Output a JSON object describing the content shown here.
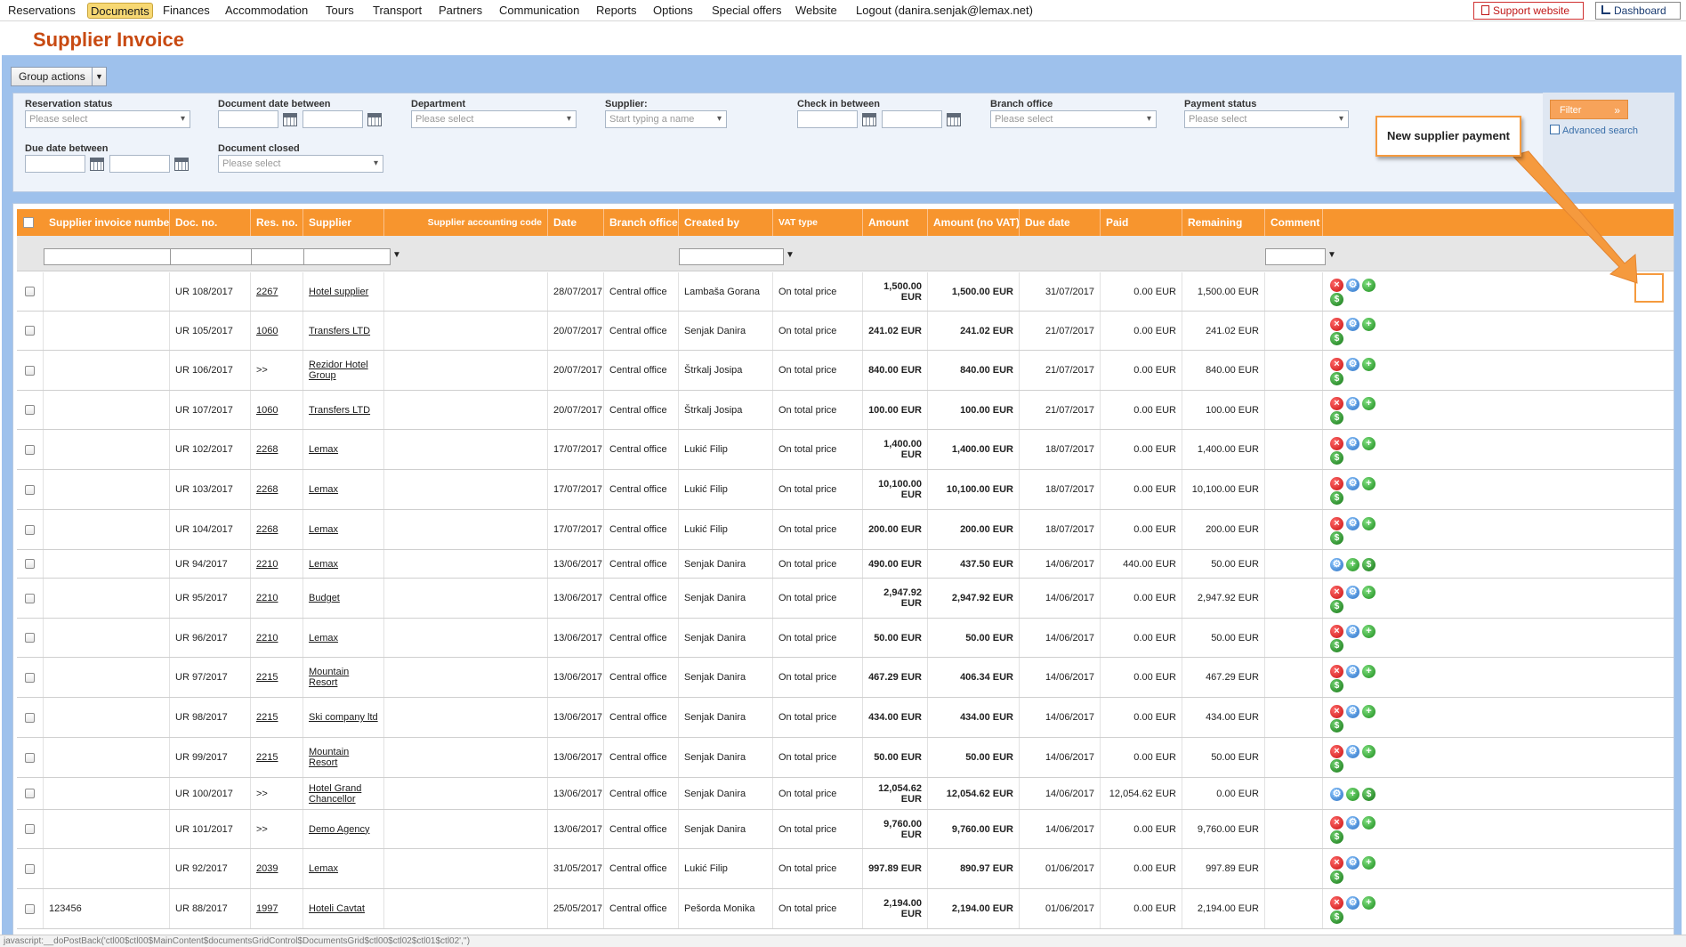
{
  "nav": {
    "items": [
      "Reservations",
      "Documents",
      "Finances",
      "Accommodation",
      "Tours",
      "Transport",
      "Partners",
      "Communication",
      "Reports",
      "Options",
      "Special offers",
      "Website",
      "Logout (danira.senjak@lemax.net)"
    ],
    "active": "Documents",
    "support_label": "Support website",
    "dashboard_label": "Dashboard"
  },
  "page": {
    "title": "Supplier Invoice"
  },
  "group_actions_label": "Group actions",
  "filters": {
    "reservation_status": {
      "label": "Reservation status",
      "placeholder": "Please select"
    },
    "document_date": {
      "label": "Document date between"
    },
    "department": {
      "label": "Department",
      "placeholder": "Please select"
    },
    "supplier": {
      "label": "Supplier:",
      "placeholder": "Start typing a name"
    },
    "check_in": {
      "label": "Check in between"
    },
    "branch_office": {
      "label": "Branch office",
      "placeholder": "Please select"
    },
    "payment_status": {
      "label": "Payment status",
      "placeholder": "Please select"
    },
    "due_date": {
      "label": "Due date between"
    },
    "document_closed": {
      "label": "Document closed",
      "placeholder": "Please select"
    },
    "filter_button": "Filter",
    "advanced_search": "Advanced search"
  },
  "callout": {
    "text": "New supplier payment"
  },
  "columns": [
    "Supplier invoice number",
    "Doc. no.",
    "Res. no.",
    "Supplier",
    "Supplier accounting code",
    "Date",
    "Branch office",
    "Created by",
    "VAT type",
    "Amount",
    "Amount (no VAT)",
    "Due date",
    "Paid",
    "Remaining",
    "Comment"
  ],
  "rows": [
    {
      "inv": "",
      "doc": "UR 108/2017",
      "res": "2267",
      "sup": "Hotel supplier",
      "date": "28/07/2017",
      "branch": "Central office",
      "by": "Lambaša Gorana",
      "vat": "On total price",
      "amt": "1,500.00 EUR",
      "amtnv": "1,500.00 EUR",
      "due": "31/07/2017",
      "paid": "0.00 EUR",
      "rem": "1,500.00 EUR"
    },
    {
      "inv": "",
      "doc": "UR 105/2017",
      "res": "1060",
      "sup": "Transfers LTD",
      "date": "20/07/2017",
      "branch": "Central office",
      "by": "Senjak Danira",
      "vat": "On total price",
      "amt": "241.02 EUR",
      "amtnv": "241.02 EUR",
      "due": "21/07/2017",
      "paid": "0.00 EUR",
      "rem": "241.02 EUR"
    },
    {
      "inv": "",
      "doc": "UR 106/2017",
      "res": ">>",
      "sup": "Rezidor Hotel Group",
      "date": "20/07/2017",
      "branch": "Central office",
      "by": "Štrkalj Josipa",
      "vat": "On total price",
      "amt": "840.00 EUR",
      "amtnv": "840.00 EUR",
      "due": "21/07/2017",
      "paid": "0.00 EUR",
      "rem": "840.00 EUR"
    },
    {
      "inv": "",
      "doc": "UR 107/2017",
      "res": "1060",
      "sup": "Transfers LTD",
      "date": "20/07/2017",
      "branch": "Central office",
      "by": "Štrkalj Josipa",
      "vat": "On total price",
      "amt": "100.00 EUR",
      "amtnv": "100.00 EUR",
      "due": "21/07/2017",
      "paid": "0.00 EUR",
      "rem": "100.00 EUR"
    },
    {
      "inv": "",
      "doc": "UR 102/2017",
      "res": "2268",
      "sup": "Lemax",
      "date": "17/07/2017",
      "branch": "Central office",
      "by": "Lukić Filip",
      "vat": "On total price",
      "amt": "1,400.00 EUR",
      "amtnv": "1,400.00 EUR",
      "due": "18/07/2017",
      "paid": "0.00 EUR",
      "rem": "1,400.00 EUR"
    },
    {
      "inv": "",
      "doc": "UR 103/2017",
      "res": "2268",
      "sup": "Lemax",
      "date": "17/07/2017",
      "branch": "Central office",
      "by": "Lukić Filip",
      "vat": "On total price",
      "amt": "10,100.00 EUR",
      "amtnv": "10,100.00 EUR",
      "due": "18/07/2017",
      "paid": "0.00 EUR",
      "rem": "10,100.00 EUR"
    },
    {
      "inv": "",
      "doc": "UR 104/2017",
      "res": "2268",
      "sup": "Lemax",
      "date": "17/07/2017",
      "branch": "Central office",
      "by": "Lukić Filip",
      "vat": "On total price",
      "amt": "200.00 EUR",
      "amtnv": "200.00 EUR",
      "due": "18/07/2017",
      "paid": "0.00 EUR",
      "rem": "200.00 EUR"
    },
    {
      "inv": "",
      "doc": "UR 94/2017",
      "res": "2210",
      "sup": "Lemax",
      "date": "13/06/2017",
      "branch": "Central office",
      "by": "Senjak Danira",
      "vat": "On total price",
      "amt": "490.00 EUR",
      "amtnv": "437.50 EUR",
      "due": "14/06/2017",
      "paid": "440.00 EUR",
      "rem": "50.00 EUR"
    },
    {
      "inv": "",
      "doc": "UR 95/2017",
      "res": "2210",
      "sup": "Budget",
      "date": "13/06/2017",
      "branch": "Central office",
      "by": "Senjak Danira",
      "vat": "On total price",
      "amt": "2,947.92 EUR",
      "amtnv": "2,947.92 EUR",
      "due": "14/06/2017",
      "paid": "0.00 EUR",
      "rem": "2,947.92 EUR"
    },
    {
      "inv": "",
      "doc": "UR 96/2017",
      "res": "2210",
      "sup": "Lemax",
      "date": "13/06/2017",
      "branch": "Central office",
      "by": "Senjak Danira",
      "vat": "On total price",
      "amt": "50.00 EUR",
      "amtnv": "50.00 EUR",
      "due": "14/06/2017",
      "paid": "0.00 EUR",
      "rem": "50.00 EUR"
    },
    {
      "inv": "",
      "doc": "UR 97/2017",
      "res": "2215",
      "sup": "Mountain Resort",
      "date": "13/06/2017",
      "branch": "Central office",
      "by": "Senjak Danira",
      "vat": "On total price",
      "amt": "467.29 EUR",
      "amtnv": "406.34 EUR",
      "due": "14/06/2017",
      "paid": "0.00 EUR",
      "rem": "467.29 EUR"
    },
    {
      "inv": "",
      "doc": "UR 98/2017",
      "res": "2215",
      "sup": "Ski company ltd",
      "date": "13/06/2017",
      "branch": "Central office",
      "by": "Senjak Danira",
      "vat": "On total price",
      "amt": "434.00 EUR",
      "amtnv": "434.00 EUR",
      "due": "14/06/2017",
      "paid": "0.00 EUR",
      "rem": "434.00 EUR"
    },
    {
      "inv": "",
      "doc": "UR 99/2017",
      "res": "2215",
      "sup": "Mountain Resort",
      "date": "13/06/2017",
      "branch": "Central office",
      "by": "Senjak Danira",
      "vat": "On total price",
      "amt": "50.00 EUR",
      "amtnv": "50.00 EUR",
      "due": "14/06/2017",
      "paid": "0.00 EUR",
      "rem": "50.00 EUR"
    },
    {
      "inv": "",
      "doc": "UR 100/2017",
      "res": ">>",
      "sup": "Hotel Grand Chancellor",
      "date": "13/06/2017",
      "branch": "Central office",
      "by": "Senjak Danira",
      "vat": "On total price",
      "amt": "12,054.62 EUR",
      "amtnv": "12,054.62 EUR",
      "due": "14/06/2017",
      "paid": "12,054.62 EUR",
      "rem": "0.00 EUR"
    },
    {
      "inv": "",
      "doc": "UR 101/2017",
      "res": ">>",
      "sup": "Demo Agency",
      "date": "13/06/2017",
      "branch": "Central office",
      "by": "Senjak Danira",
      "vat": "On total price",
      "amt": "9,760.00 EUR",
      "amtnv": "9,760.00 EUR",
      "due": "14/06/2017",
      "paid": "0.00 EUR",
      "rem": "9,760.00 EUR"
    },
    {
      "inv": "",
      "doc": "UR 92/2017",
      "res": "2039",
      "sup": "Lemax",
      "date": "31/05/2017",
      "branch": "Central office",
      "by": "Lukić Filip",
      "vat": "On total price",
      "amt": "997.89 EUR",
      "amtnv": "890.97 EUR",
      "due": "01/06/2017",
      "paid": "0.00 EUR",
      "rem": "997.89 EUR"
    },
    {
      "inv": "123456",
      "doc": "UR 88/2017",
      "res": "1997",
      "sup": "Hoteli Cavtat",
      "date": "25/05/2017",
      "branch": "Central office",
      "by": "Pešorda Monika",
      "vat": "On total price",
      "amt": "2,194.00 EUR",
      "amtnv": "2,194.00 EUR",
      "due": "01/06/2017",
      "paid": "0.00 EUR",
      "rem": "2,194.00 EUR"
    }
  ],
  "status_bar": "javascript:__doPostBack('ctl00$ctl00$MainContent$documentsGridControl$DocumentsGrid$ctl00$ctl02$ctl01$ctl02','')"
}
